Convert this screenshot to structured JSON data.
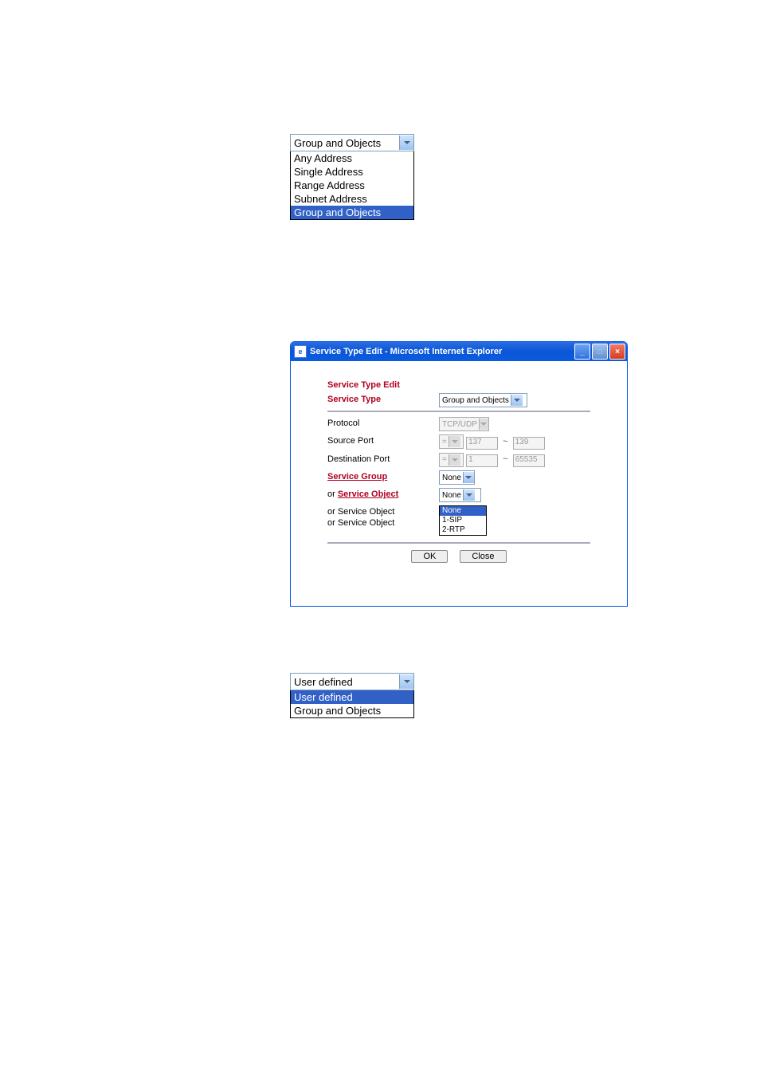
{
  "dropdown1": {
    "selected": "Group and Objects",
    "options": [
      "Any Address",
      "Single Address",
      "Range Address",
      "Subnet Address",
      "Group and Objects"
    ],
    "highlighted": "Group and Objects"
  },
  "ie_window": {
    "title": "Service Type Edit - Microsoft Internet Explorer",
    "section_title": "Service Type Edit",
    "rows": {
      "service_type_label": "Service Type",
      "service_type_value": "Group and Objects",
      "protocol_label": "Protocol",
      "protocol_value": "TCP/UDP",
      "source_port_label": "Source Port",
      "source_port_op": "=",
      "source_port_from": "137",
      "source_port_to": "139",
      "dest_port_label": "Destination Port",
      "dest_port_op": "=",
      "dest_port_from": "1",
      "dest_port_to": "65535",
      "service_group_label": "Service Group",
      "service_group_value": "None",
      "or_text": "or",
      "service_object_label": "Service Object",
      "service_object_value": "None",
      "service_object2_label": "or Service Object",
      "service_object3_label": "or Service Object",
      "dd_options": [
        "None",
        "1-SIP",
        "2-RTP"
      ],
      "dd_highlight": "None"
    },
    "ok_label": "OK",
    "close_label": "Close"
  },
  "dropdown3": {
    "selected": "User defined",
    "options": [
      "User defined",
      "Group and Objects"
    ],
    "highlighted": "User defined"
  }
}
